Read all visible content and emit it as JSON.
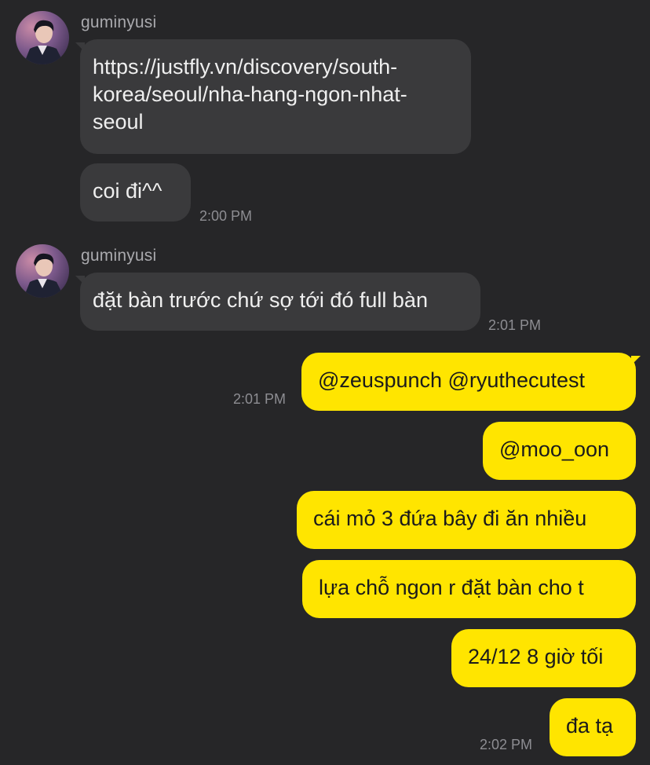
{
  "chat": {
    "groups": [
      {
        "sender": "guminyusi",
        "avatar_icon": "profile-photo-icon",
        "messages": [
          {
            "text_lines": [
              "https://justfly.vn/discovery/south-",
              "korea/seoul/nha-hang-ngon-nhat-",
              "seoul"
            ]
          },
          {
            "text": "coi đi^^",
            "time": "2:00 PM"
          }
        ]
      },
      {
        "sender": "guminyusi",
        "avatar_icon": "profile-photo-icon",
        "messages": [
          {
            "text": "đặt bàn trước chứ sợ tới đó full bàn",
            "time": "2:01 PM"
          }
        ]
      }
    ],
    "outgoing": [
      {
        "text": "@zeuspunch @ryuthecutest",
        "time": "2:01 PM"
      },
      {
        "text": "@moo_oon"
      },
      {
        "text": "cái mỏ 3 đứa bây đi ăn nhiều"
      },
      {
        "text": "lựa chỗ ngon r đặt bàn cho t"
      },
      {
        "text": "24/12 8 giờ tối"
      },
      {
        "text": "đa tạ",
        "time": "2:02 PM"
      }
    ]
  },
  "colors": {
    "background": "#262628",
    "incoming_bubble": "#3a3a3c",
    "outgoing_bubble": "#ffe500",
    "timestamp": "#8d8d92",
    "sender_name": "#a9a9ad"
  }
}
